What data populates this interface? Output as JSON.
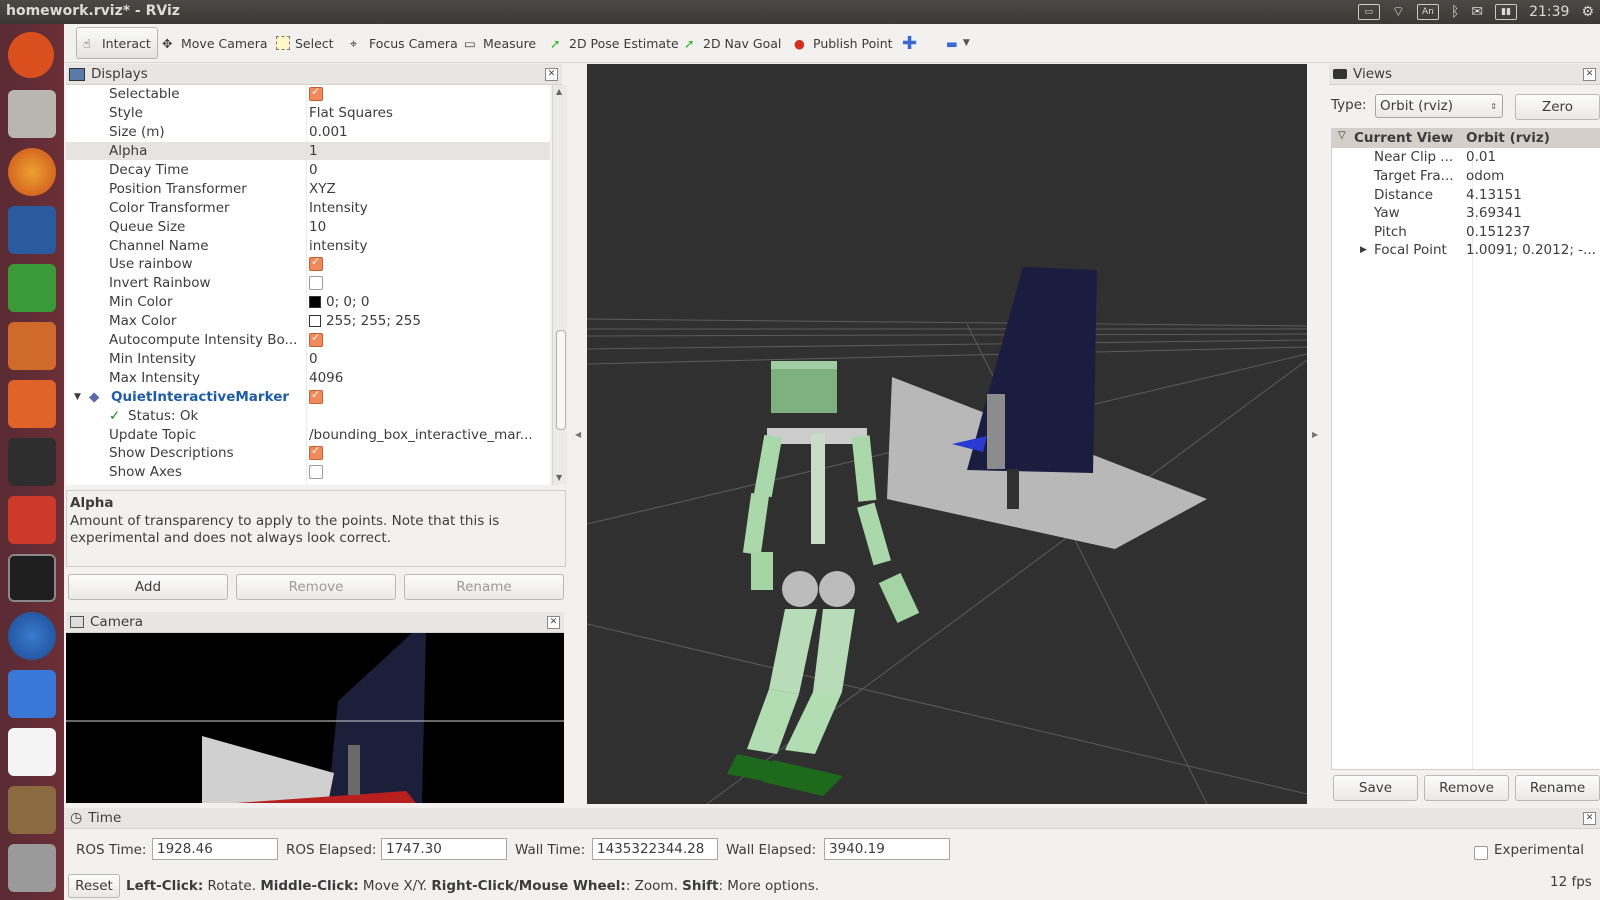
{
  "window": {
    "title": "homework.rviz* - RViz",
    "clock": "21:39",
    "keyboard": "An"
  },
  "toolbar": {
    "interact": "Interact",
    "move_camera": "Move Camera",
    "select": "Select",
    "focus_camera": "Focus Camera",
    "measure": "Measure",
    "pose_estimate": "2D Pose Estimate",
    "nav_goal": "2D Nav Goal",
    "publish_point": "Publish Point"
  },
  "displays": {
    "title": "Displays",
    "rows": [
      {
        "name": "Selectable",
        "value": "",
        "check": true
      },
      {
        "name": "Style",
        "value": "Flat Squares"
      },
      {
        "name": "Size (m)",
        "value": "0.001"
      },
      {
        "name": "Alpha",
        "value": "1"
      },
      {
        "name": "Decay Time",
        "value": "0"
      },
      {
        "name": "Position Transformer",
        "value": "XYZ"
      },
      {
        "name": "Color Transformer",
        "value": "Intensity"
      },
      {
        "name": "Queue Size",
        "value": "10"
      },
      {
        "name": "Channel Name",
        "value": "intensity"
      },
      {
        "name": "Use rainbow",
        "value": "",
        "check": true
      },
      {
        "name": "Invert Rainbow",
        "value": "",
        "check": false
      },
      {
        "name": "Min Color",
        "value": "0; 0; 0"
      },
      {
        "name": "Max Color",
        "value": "255; 255; 255"
      },
      {
        "name": "Autocompute Intensity Bo...",
        "value": "",
        "check": true
      },
      {
        "name": "Min Intensity",
        "value": "0"
      },
      {
        "name": "Max Intensity",
        "value": "4096"
      },
      {
        "name": "QuietInteractiveMarker",
        "value": "",
        "check": true
      },
      {
        "name": "Status: Ok",
        "value": ""
      },
      {
        "name": "Update Topic",
        "value": "/bounding_box_interactive_mar..."
      },
      {
        "name": "Show Descriptions",
        "value": "",
        "check": true
      },
      {
        "name": "Show Axes",
        "value": "",
        "check": false
      }
    ],
    "help_title": "Alpha",
    "help_text": "Amount of transparency to apply to the points. Note that this is experimental and does not always look correct.",
    "add": "Add",
    "remove": "Remove",
    "rename": "Rename"
  },
  "camera": {
    "title": "Camera"
  },
  "views": {
    "title": "Views",
    "type_label": "Type:",
    "type_value": "Orbit (rviz)",
    "zero": "Zero",
    "header_name": "Current View",
    "header_value": "Orbit (rviz)",
    "rows": [
      {
        "name": "Near Clip ...",
        "value": "0.01"
      },
      {
        "name": "Target Fra...",
        "value": "odom"
      },
      {
        "name": "Distance",
        "value": "4.13151"
      },
      {
        "name": "Yaw",
        "value": "3.69341"
      },
      {
        "name": "Pitch",
        "value": "0.151237"
      },
      {
        "name": "Focal Point",
        "value": "1.0091; 0.2012; -..."
      }
    ],
    "save": "Save",
    "remove": "Remove",
    "rename": "Rename"
  },
  "time": {
    "title": "Time",
    "ros_time_label": "ROS Time:",
    "ros_time": "1928.46",
    "ros_elapsed_label": "ROS Elapsed:",
    "ros_elapsed": "1747.30",
    "wall_time_label": "Wall Time:",
    "wall_time": "1435322344.28",
    "wall_elapsed_label": "Wall Elapsed:",
    "wall_elapsed": "3940.19",
    "experimental": "Experimental"
  },
  "status": {
    "reset": "Reset",
    "k1": "Left-Click:",
    "v1": " Rotate. ",
    "k2": "Middle-Click:",
    "v2": " Move X/Y. ",
    "k3": "Right-Click/Mouse Wheel:",
    "v3": ": Zoom. ",
    "k4": "Shift",
    "v4": ": More options.",
    "fps": "12 fps"
  }
}
